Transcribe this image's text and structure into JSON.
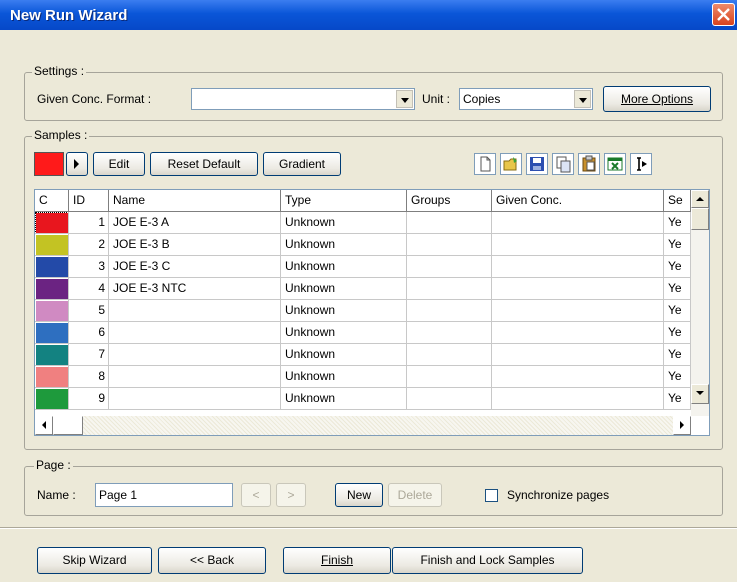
{
  "window": {
    "title": "New Run Wizard"
  },
  "settings": {
    "group_label": "Settings :",
    "given_conc_label": "Given Conc. Format :",
    "given_conc_value": "",
    "unit_label": "Unit :",
    "unit_value": "Copies",
    "more_options": "More Options"
  },
  "samples": {
    "group_label": "Samples :",
    "current_color": "#ff1a1a",
    "edit": "Edit",
    "reset_default": "Reset Default",
    "gradient": "Gradient",
    "toolbar_icons": [
      "new-document-icon",
      "open-folder-icon",
      "save-disk-icon",
      "copy-icon",
      "paste-icon",
      "excel-export-icon",
      "text-cursor-icon"
    ],
    "columns": [
      "C",
      "ID",
      "Name",
      "Type",
      "Groups",
      "Given Conc.",
      "Se"
    ],
    "rows": [
      {
        "color": "#e8161e",
        "id": "1",
        "name": "JOE E-3 A",
        "type": "Unknown",
        "groups": "",
        "given": "",
        "se": "Ye"
      },
      {
        "color": "#c3c323",
        "id": "2",
        "name": "JOE E-3 B",
        "type": "Unknown",
        "groups": "",
        "given": "",
        "se": "Ye"
      },
      {
        "color": "#234aa8",
        "id": "3",
        "name": "JOE E-3 C",
        "type": "Unknown",
        "groups": "",
        "given": "",
        "se": "Ye"
      },
      {
        "color": "#6b2382",
        "id": "4",
        "name": "JOE E-3 NTC",
        "type": "Unknown",
        "groups": "",
        "given": "",
        "se": "Ye"
      },
      {
        "color": "#d08ac2",
        "id": "5",
        "name": "",
        "type": "Unknown",
        "groups": "",
        "given": "",
        "se": "Ye"
      },
      {
        "color": "#2e6fc0",
        "id": "6",
        "name": "",
        "type": "Unknown",
        "groups": "",
        "given": "",
        "se": "Ye"
      },
      {
        "color": "#138281",
        "id": "7",
        "name": "",
        "type": "Unknown",
        "groups": "",
        "given": "",
        "se": "Ye"
      },
      {
        "color": "#f08080",
        "id": "8",
        "name": "",
        "type": "Unknown",
        "groups": "",
        "given": "",
        "se": "Ye"
      },
      {
        "color": "#1e9a3c",
        "id": "9",
        "name": "",
        "type": "Unknown",
        "groups": "",
        "given": "",
        "se": "Ye"
      }
    ]
  },
  "page": {
    "group_label": "Page :",
    "name_label": "Name :",
    "name_value": "Page 1",
    "prev": "<",
    "next": ">",
    "new": "New",
    "delete": "Delete",
    "sync_label": "Synchronize pages",
    "sync_checked": false
  },
  "footer": {
    "skip": "Skip Wizard",
    "back": "<< Back",
    "finish": "Finish",
    "finish_lock": "Finish and Lock Samples"
  }
}
